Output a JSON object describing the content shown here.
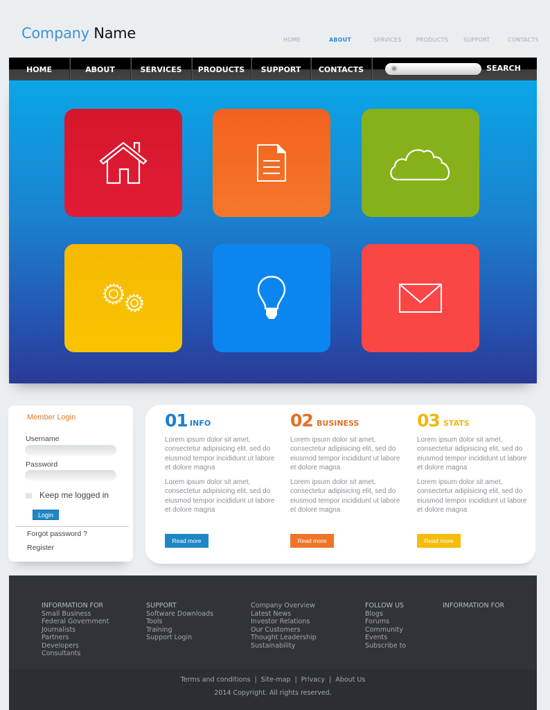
{
  "header": {
    "logo_part1": "Company",
    "logo_part2": "Name",
    "topnav": [
      {
        "label": "HOME",
        "active": false
      },
      {
        "label": "ABOUT",
        "active": true
      },
      {
        "label": "SERVICES",
        "active": false
      },
      {
        "label": "PRODUCTS",
        "active": false
      },
      {
        "label": "SUPPORT",
        "active": false
      },
      {
        "label": "CONTACTS",
        "active": false
      }
    ]
  },
  "mainnav": {
    "items": [
      "HOME",
      "ABOUT",
      "SERVICES",
      "PRODUCTS",
      "SUPPORT",
      "CONTACTS"
    ],
    "search_value": "",
    "search_label": "SEARCH"
  },
  "hero": {
    "tiles": [
      {
        "icon": "home-icon",
        "color": "#d9192f"
      },
      {
        "icon": "document-icon",
        "color": "#f26a20"
      },
      {
        "icon": "cloud-icon",
        "color": "#86b11a"
      },
      {
        "icon": "gears-icon",
        "color": "#f7be06"
      },
      {
        "icon": "lightbulb-icon",
        "color": "#0b86f0"
      },
      {
        "icon": "envelope-icon",
        "color": "#fb4646"
      }
    ]
  },
  "login": {
    "title": "Member Login",
    "username_label": "Username",
    "username_value": "",
    "password_label": "Password",
    "password_value": "",
    "keep_logged_in": "Keep me logged in",
    "login_button": "Login",
    "forgot_password": "Forgot password ?",
    "register": "Register"
  },
  "info": {
    "columns": [
      {
        "number": "01",
        "heading": "INFO",
        "color": "#1a7fd0",
        "paragraphs": [
          "Lorem ipsum dolor sit amet, consectetur adipisicing elit, sed do eiusmod tempor incididunt ut labore et dolore magna",
          "Lorem ipsum dolor sit amet, consectetur adipisicing elit, sed do eiusmod tempor incididunt ut labore et dolore magna"
        ],
        "button": "Read more",
        "button_color": "#1f87c6"
      },
      {
        "number": "02",
        "heading": "BUSINESS",
        "color": "#e66d24",
        "paragraphs": [
          "Lorem ipsum dolor sit amet, consectetur adipisicing elit, sed do eiusmod tempor incididunt ut labore et dolore magna",
          "Lorem ipsum dolor sit amet, consectetur adipisicing elit, sed do eiusmod tempor incididunt ut labore et dolore magna"
        ],
        "button": "Read more",
        "button_color": "#f07428"
      },
      {
        "number": "03",
        "heading": "STATS",
        "color": "#f0b70c",
        "paragraphs": [
          "Lorem ipsum dolor sit amet, consectetur adipisicing elit, sed do eiusmod tempor incididunt ut labore et dolore magna",
          "Lorem ipsum dolor sit amet, consectetur adipisicing elit, sed do eiusmod tempor incididunt ut labore et dolore magna"
        ],
        "button": "Read more",
        "button_color": "#f5bd0a"
      }
    ]
  },
  "footer": {
    "columns": [
      {
        "heading": "INFORMATION FOR",
        "links": [
          "Small Business",
          "Federal Government",
          "Journalists",
          "Partners",
          "Developers",
          "Consultants"
        ]
      },
      {
        "heading": "SUPPORT",
        "links": [
          "Software Downloads",
          "Tools",
          "Training",
          "Support Login"
        ]
      },
      {
        "heading": "",
        "links": [
          "Company Overview",
          "Latest News",
          "Investor Relations",
          "Our Customers",
          "Thought Leadership",
          "Sustainability"
        ]
      },
      {
        "heading": "FOLLOW US",
        "links": [
          "Blogs",
          "Forums",
          "Community",
          "Events",
          "Subscribe to"
        ]
      },
      {
        "heading": "INFORMATION FOR",
        "links": []
      }
    ],
    "bottom_links": [
      "Terms and conditions",
      "Site-map",
      "Privacy",
      "About Us"
    ],
    "copyright": "2014 Copyright. All rights reserved."
  }
}
